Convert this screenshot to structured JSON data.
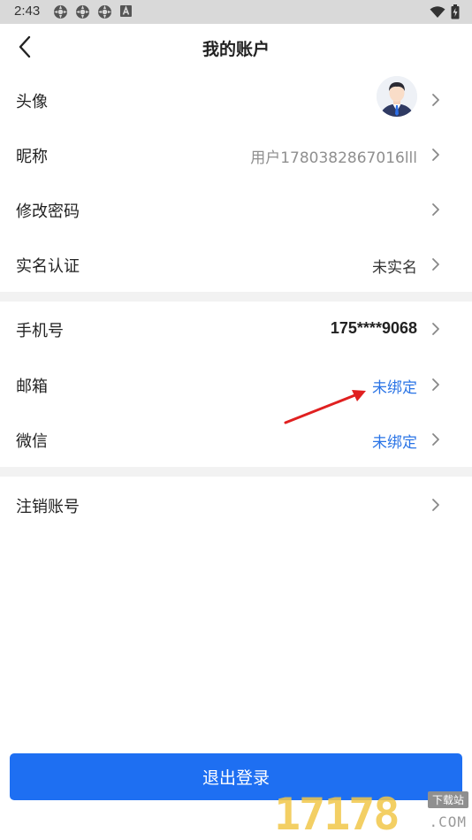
{
  "status_bar": {
    "time": "2:43",
    "icons": [
      "settings-icon",
      "settings-icon",
      "settings-icon",
      "notification-a-icon"
    ],
    "right_icons": [
      "wifi-icon",
      "battery-icon"
    ]
  },
  "header": {
    "title": "我的账户",
    "back_icon": "back-arrow-icon"
  },
  "rows": [
    {
      "label": "头像",
      "value": "",
      "type": "avatar"
    },
    {
      "label": "昵称",
      "value": "用户1780382867016lll",
      "style": "muted"
    },
    {
      "label": "修改密码",
      "value": ""
    },
    {
      "label": "实名认证",
      "value": "未实名",
      "style": "normal"
    },
    {
      "label": "手机号",
      "value": "175****9068",
      "style": "bold"
    },
    {
      "label": "邮箱",
      "value": "未绑定",
      "style": "blue"
    },
    {
      "label": "微信",
      "value": "未绑定",
      "style": "blue"
    },
    {
      "label": "注销账号",
      "value": ""
    }
  ],
  "logout_button": {
    "label": "退出登录"
  },
  "colors": {
    "accent_blue": "#1e6ff2",
    "link_blue": "#2a74e6",
    "annotation_red": "#e02020",
    "divider": "#f2f2f2"
  },
  "watermark": {
    "digits": "17178",
    "tag": "下载站",
    "domain": ".COM"
  }
}
